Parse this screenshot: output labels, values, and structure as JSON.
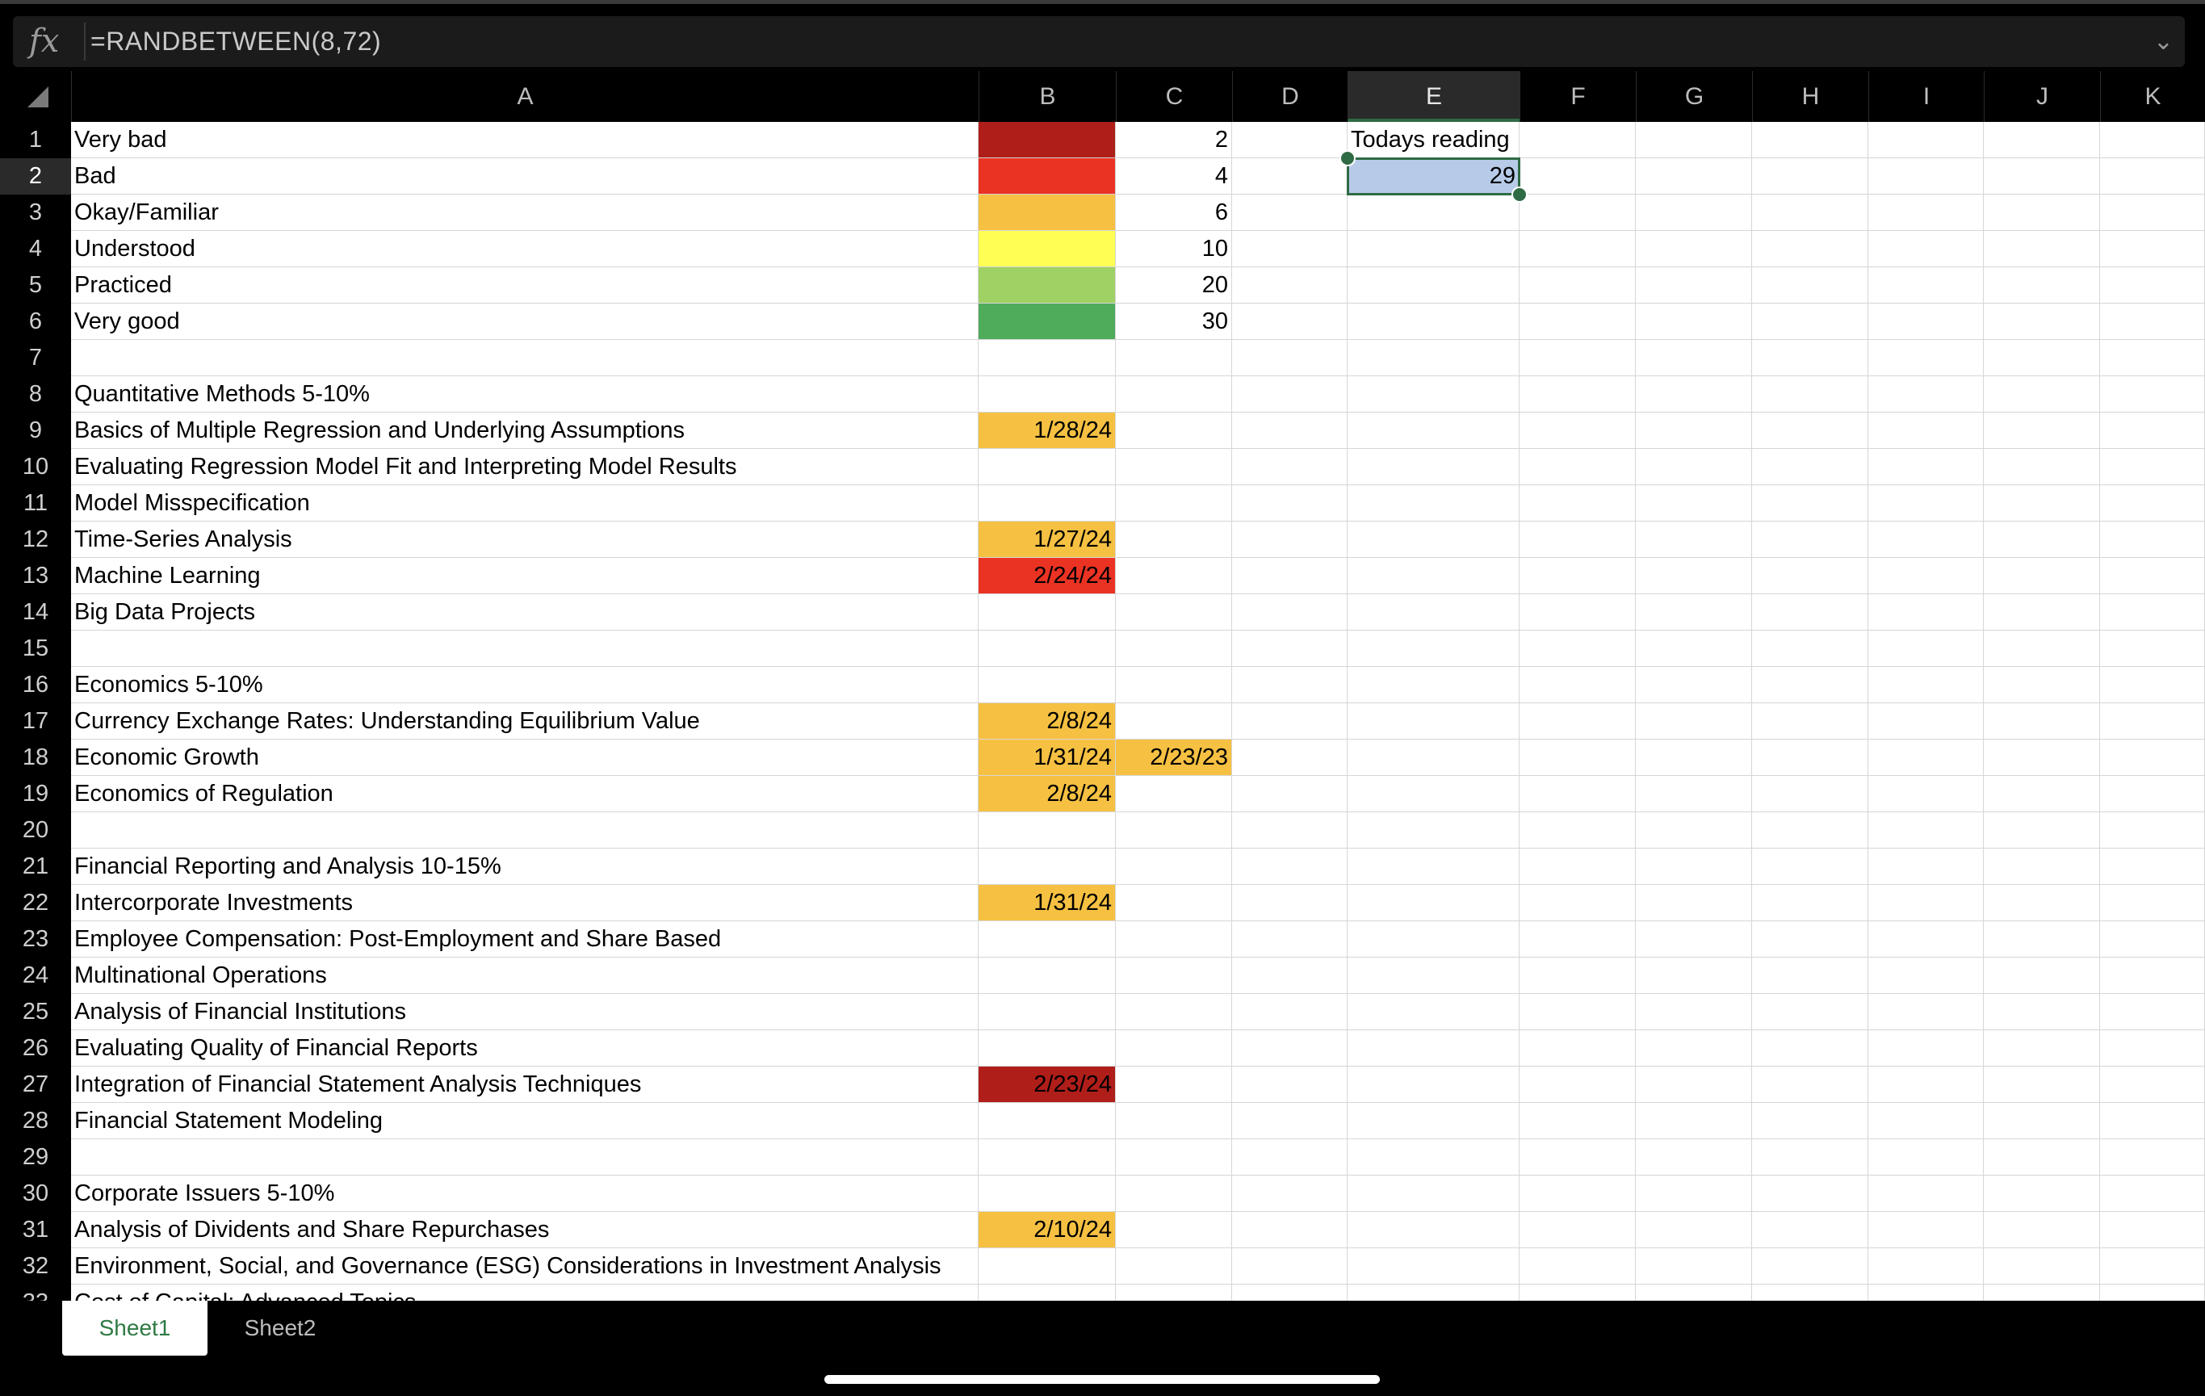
{
  "formula_bar": {
    "fx_label": "fx",
    "formula": "=RANDBETWEEN(8,72)",
    "expand_icon": "chevron-down-icon"
  },
  "columns": [
    "A",
    "B",
    "C",
    "D",
    "E",
    "F",
    "G",
    "H",
    "I",
    "J",
    "K"
  ],
  "active_column": "E",
  "active_row": 2,
  "rows": [
    {
      "n": "1",
      "A": "Very bad",
      "B": "",
      "B_color": "#b01e1a",
      "C": "2",
      "E": "Todays reading"
    },
    {
      "n": "2",
      "A": "Bad",
      "B": "",
      "B_color": "#ea3323",
      "C": "4",
      "E": "29"
    },
    {
      "n": "3",
      "A": "Okay/Familiar",
      "B": "",
      "B_color": "#f6c142",
      "C": "6"
    },
    {
      "n": "4",
      "A": "Understood",
      "B": "",
      "B_color": "#fffe54",
      "C": "10"
    },
    {
      "n": "5",
      "A": "Practiced",
      "B": "",
      "B_color": "#a0d164",
      "C": "20"
    },
    {
      "n": "6",
      "A": "Very good",
      "B": "",
      "B_color": "#4eac5b",
      "C": "30"
    },
    {
      "n": "7",
      "A": ""
    },
    {
      "n": "8",
      "A": "Quantitative Methods 5-10%"
    },
    {
      "n": "9",
      "A": "Basics of Multiple Regression and Underlying Assumptions",
      "B": "1/28/24",
      "B_color": "#f6c142"
    },
    {
      "n": "10",
      "A": "Evaluating Regression Model Fit and Interpreting Model Results"
    },
    {
      "n": "11",
      "A": "Model Misspecification"
    },
    {
      "n": "12",
      "A": "Time-Series Analysis",
      "B": "1/27/24",
      "B_color": "#f6c142"
    },
    {
      "n": "13",
      "A": "Machine Learning",
      "B": "2/24/24",
      "B_color": "#ea3323"
    },
    {
      "n": "14",
      "A": "Big Data Projects"
    },
    {
      "n": "15",
      "A": ""
    },
    {
      "n": "16",
      "A": "Economics 5-10%"
    },
    {
      "n": "17",
      "A": "Currency Exchange Rates: Understanding Equilibrium Value",
      "B": "2/8/24",
      "B_color": "#f6c142"
    },
    {
      "n": "18",
      "A": "Economic Growth",
      "B": "1/31/24",
      "B_color": "#f6c142",
      "C": "2/23/23",
      "C_color": "#f6c142"
    },
    {
      "n": "19",
      "A": "Economics of Regulation",
      "B": "2/8/24",
      "B_color": "#f6c142"
    },
    {
      "n": "20",
      "A": ""
    },
    {
      "n": "21",
      "A": "Financial Reporting and Analysis 10-15%"
    },
    {
      "n": "22",
      "A": "Intercorporate Investments",
      "B": "1/31/24",
      "B_color": "#f6c142"
    },
    {
      "n": "23",
      "A": "Employee Compensation: Post-Employment and Share Based"
    },
    {
      "n": "24",
      "A": "Multinational Operations"
    },
    {
      "n": "25",
      "A": "Analysis of Financial Institutions"
    },
    {
      "n": "26",
      "A": "Evaluating Quality of Financial Reports"
    },
    {
      "n": "27",
      "A": "Integration of Financial Statement Analysis Techniques",
      "B": "2/23/24",
      "B_color": "#b01e1a"
    },
    {
      "n": "28",
      "A": "Financial Statement Modeling"
    },
    {
      "n": "29",
      "A": ""
    },
    {
      "n": "30",
      "A": "Corporate Issuers 5-10%"
    },
    {
      "n": "31",
      "A": "Analysis of Dividents and Share Repurchases",
      "B": "2/10/24",
      "B_color": "#f6c142"
    },
    {
      "n": "32",
      "A": "Environment, Social, and Governance (ESG) Considerations in Investment Analysis"
    },
    {
      "n": "33",
      "A": "Cost of Capital: Advanced Topics"
    }
  ],
  "sheets": [
    {
      "label": "Sheet1",
      "active": true
    },
    {
      "label": "Sheet2",
      "active": false
    }
  ]
}
